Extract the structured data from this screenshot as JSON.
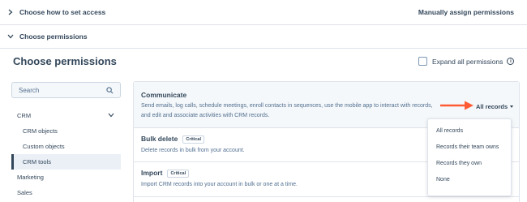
{
  "access_row": {
    "title": "Choose how to set access",
    "action": "Manually assign permissions"
  },
  "permissions_row": {
    "title": "Choose permissions"
  },
  "page": {
    "title": "Choose permissions",
    "expand_label": "Expand all permissions",
    "info_icon": "i"
  },
  "search": {
    "placeholder": "Search"
  },
  "sidebar": {
    "items": [
      {
        "label": "CRM"
      },
      {
        "label": "CRM objects"
      },
      {
        "label": "Custom objects"
      },
      {
        "label": "CRM tools"
      },
      {
        "label": "Marketing"
      },
      {
        "label": "Sales"
      }
    ]
  },
  "permissions": [
    {
      "name": "Communicate",
      "description": "Send emails, log calls, schedule meetings, enroll contacts in sequences, use the mobile app to interact with records, and edit and associate activities with CRM records.",
      "value": "All records"
    },
    {
      "name": "Bulk delete",
      "badge": "Critical",
      "description": "Delete records in bulk from your account."
    },
    {
      "name": "Import",
      "badge": "Critical",
      "description": "Import CRM records into your account in bulk or one at a time."
    }
  ],
  "dropdown": {
    "options": [
      "All records",
      "Records their team owns",
      "Records they own",
      "None"
    ]
  },
  "colors": {
    "text": "#33475b",
    "border": "#dfe3eb",
    "arrow": "#ff5c35",
    "active_bg": "#eaf0f6"
  }
}
